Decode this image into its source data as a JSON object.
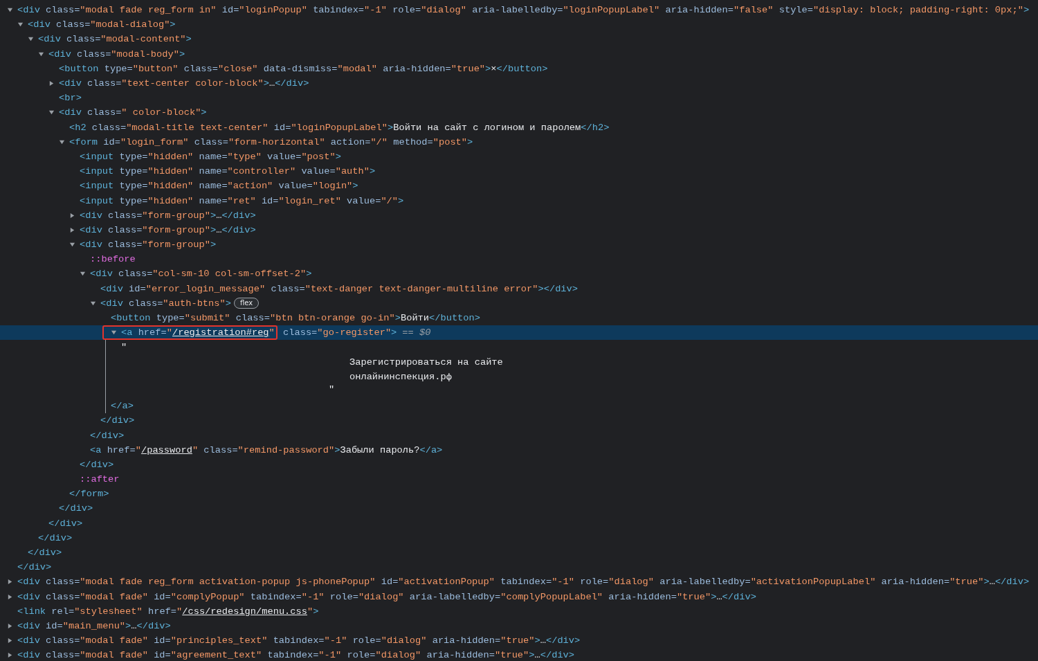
{
  "tree": [
    {
      "selected": false,
      "expanded": true,
      "open": [
        {
          "tag": "<div"
        },
        {
          "attr": " class="
        },
        {
          "val": "\"modal fade reg_form in\""
        },
        {
          "attr": " id="
        },
        {
          "val": "\"loginPopup\""
        },
        {
          "attr": " tabindex="
        },
        {
          "val": "\"-1\""
        },
        {
          "attr": " role="
        },
        {
          "val": "\"dialog\""
        },
        {
          "attr": " aria-labelledby="
        },
        {
          "val": "\"loginPopupLabel\""
        },
        {
          "attr": " aria-hidden="
        },
        {
          "val": "\"false\""
        },
        {
          "attr": " style="
        },
        {
          "val": "\"display: block; padding-right: 0px;\""
        },
        {
          "tag": ">"
        }
      ],
      "close": [
        {
          "tag": "</div>"
        }
      ],
      "children": [
        {
          "selected": false,
          "expanded": true,
          "open": [
            {
              "tag": "<div"
            },
            {
              "attr": " class="
            },
            {
              "val": "\"modal-dialog\""
            },
            {
              "tag": ">"
            }
          ],
          "close": [
            {
              "tag": "</div>"
            }
          ],
          "children": [
            {
              "selected": false,
              "expanded": true,
              "open": [
                {
                  "tag": "<div"
                },
                {
                  "attr": " class="
                },
                {
                  "val": "\"modal-content\""
                },
                {
                  "tag": ">"
                }
              ],
              "close": [
                {
                  "tag": "</div>"
                }
              ],
              "children": [
                {
                  "selected": false,
                  "expanded": true,
                  "open": [
                    {
                      "tag": "<div"
                    },
                    {
                      "attr": " class="
                    },
                    {
                      "val": "\"modal-body\""
                    },
                    {
                      "tag": ">"
                    }
                  ],
                  "close": [
                    {
                      "tag": "</div>"
                    }
                  ],
                  "children": [
                    {
                      "selected": false,
                      "open": [
                        {
                          "tag": "<button"
                        },
                        {
                          "attr": " type="
                        },
                        {
                          "val": "\"button\""
                        },
                        {
                          "attr": " class="
                        },
                        {
                          "val": "\"close\""
                        },
                        {
                          "attr": " data-dismiss="
                        },
                        {
                          "val": "\"modal\""
                        },
                        {
                          "attr": " aria-hidden="
                        },
                        {
                          "val": "\"true\""
                        },
                        {
                          "tag": ">"
                        },
                        {
                          "text": "×"
                        },
                        {
                          "tag": "</button>"
                        }
                      ]
                    },
                    {
                      "selected": false,
                      "expanded": false,
                      "open": [
                        {
                          "tag": "<div"
                        },
                        {
                          "attr": " class="
                        },
                        {
                          "val": "\"text-center color-block\""
                        },
                        {
                          "tag": ">"
                        },
                        {
                          "text": "…"
                        },
                        {
                          "tag": "</div>"
                        }
                      ]
                    },
                    {
                      "selected": false,
                      "open": [
                        {
                          "tag": "<br>"
                        }
                      ]
                    },
                    {
                      "selected": false,
                      "expanded": true,
                      "open": [
                        {
                          "tag": "<div"
                        },
                        {
                          "attr": " class="
                        },
                        {
                          "val": "\" color-block\""
                        },
                        {
                          "tag": ">"
                        }
                      ],
                      "close": [
                        {
                          "tag": "</div>"
                        }
                      ],
                      "children": [
                        {
                          "selected": false,
                          "open": [
                            {
                              "tag": "<h2"
                            },
                            {
                              "attr": " class="
                            },
                            {
                              "val": "\"modal-title text-center\""
                            },
                            {
                              "attr": " id="
                            },
                            {
                              "val": "\"loginPopupLabel\""
                            },
                            {
                              "tag": ">"
                            },
                            {
                              "text": "Войти на сайт с логином и паролем"
                            },
                            {
                              "tag": "</h2>"
                            }
                          ]
                        },
                        {
                          "selected": false,
                          "expanded": true,
                          "open": [
                            {
                              "tag": "<form"
                            },
                            {
                              "attr": " id="
                            },
                            {
                              "val": "\"login_form\""
                            },
                            {
                              "attr": " class="
                            },
                            {
                              "val": "\"form-horizontal\""
                            },
                            {
                              "attr": " action="
                            },
                            {
                              "val": "\"/\""
                            },
                            {
                              "attr": " method="
                            },
                            {
                              "val": "\"post\""
                            },
                            {
                              "tag": ">"
                            }
                          ],
                          "close": [
                            {
                              "tag": "</form>"
                            }
                          ],
                          "children": [
                            {
                              "selected": false,
                              "open": [
                                {
                                  "tag": "<input"
                                },
                                {
                                  "attr": " type="
                                },
                                {
                                  "val": "\"hidden\""
                                },
                                {
                                  "attr": " name="
                                },
                                {
                                  "val": "\"type\""
                                },
                                {
                                  "attr": " value="
                                },
                                {
                                  "val": "\"post\""
                                },
                                {
                                  "tag": ">"
                                }
                              ]
                            },
                            {
                              "selected": false,
                              "open": [
                                {
                                  "tag": "<input"
                                },
                                {
                                  "attr": " type="
                                },
                                {
                                  "val": "\"hidden\""
                                },
                                {
                                  "attr": " name="
                                },
                                {
                                  "val": "\"controller\""
                                },
                                {
                                  "attr": " value="
                                },
                                {
                                  "val": "\"auth\""
                                },
                                {
                                  "tag": ">"
                                }
                              ]
                            },
                            {
                              "selected": false,
                              "open": [
                                {
                                  "tag": "<input"
                                },
                                {
                                  "attr": " type="
                                },
                                {
                                  "val": "\"hidden\""
                                },
                                {
                                  "attr": " name="
                                },
                                {
                                  "val": "\"action\""
                                },
                                {
                                  "attr": " value="
                                },
                                {
                                  "val": "\"login\""
                                },
                                {
                                  "tag": ">"
                                }
                              ]
                            },
                            {
                              "selected": false,
                              "open": [
                                {
                                  "tag": "<input"
                                },
                                {
                                  "attr": " type="
                                },
                                {
                                  "val": "\"hidden\""
                                },
                                {
                                  "attr": " name="
                                },
                                {
                                  "val": "\"ret\""
                                },
                                {
                                  "attr": " id="
                                },
                                {
                                  "val": "\"login_ret\""
                                },
                                {
                                  "attr": " value="
                                },
                                {
                                  "val": "\"/\""
                                },
                                {
                                  "tag": ">"
                                }
                              ]
                            },
                            {
                              "selected": false,
                              "expanded": false,
                              "open": [
                                {
                                  "tag": "<div"
                                },
                                {
                                  "attr": " class="
                                },
                                {
                                  "val": "\"form-group\""
                                },
                                {
                                  "tag": ">"
                                },
                                {
                                  "text": "…"
                                },
                                {
                                  "tag": "</div>"
                                }
                              ]
                            },
                            {
                              "selected": false,
                              "expanded": false,
                              "open": [
                                {
                                  "tag": "<div"
                                },
                                {
                                  "attr": " class="
                                },
                                {
                                  "val": "\"form-group\""
                                },
                                {
                                  "tag": ">"
                                },
                                {
                                  "text": "…"
                                },
                                {
                                  "tag": "</div>"
                                }
                              ]
                            },
                            {
                              "selected": false,
                              "expanded": true,
                              "open": [
                                {
                                  "tag": "<div"
                                },
                                {
                                  "attr": " class="
                                },
                                {
                                  "val": "\"form-group\""
                                },
                                {
                                  "tag": ">"
                                }
                              ],
                              "close": [
                                {
                                  "tag": "</div>"
                                }
                              ],
                              "children": [
                                {
                                  "selected": false,
                                  "open": [
                                    {
                                      "pseudo": "::before"
                                    }
                                  ]
                                },
                                {
                                  "selected": false,
                                  "expanded": true,
                                  "open": [
                                    {
                                      "tag": "<div"
                                    },
                                    {
                                      "attr": " class="
                                    },
                                    {
                                      "val": "\"col-sm-10 col-sm-offset-2\""
                                    },
                                    {
                                      "tag": ">"
                                    }
                                  ],
                                  "close": [
                                    {
                                      "tag": "</div>"
                                    }
                                  ],
                                  "children": [
                                    {
                                      "selected": false,
                                      "open": [
                                        {
                                          "tag": "<div"
                                        },
                                        {
                                          "attr": " id="
                                        },
                                        {
                                          "val": "\"error_login_message\""
                                        },
                                        {
                                          "attr": " class="
                                        },
                                        {
                                          "val": "\"text-danger text-danger-multiline error\""
                                        },
                                        {
                                          "tag": ">"
                                        },
                                        {
                                          "tag": "</div>"
                                        }
                                      ]
                                    },
                                    {
                                      "selected": false,
                                      "expanded": true,
                                      "badge": "flex",
                                      "open": [
                                        {
                                          "tag": "<div"
                                        },
                                        {
                                          "attr": " class="
                                        },
                                        {
                                          "val": "\"auth-btns\""
                                        },
                                        {
                                          "tag": ">"
                                        }
                                      ],
                                      "close": [
                                        {
                                          "tag": "</div>"
                                        }
                                      ],
                                      "children": [
                                        {
                                          "selected": false,
                                          "open": [
                                            {
                                              "tag": "<button"
                                            },
                                            {
                                              "attr": " type="
                                            },
                                            {
                                              "val": "\"submit\""
                                            },
                                            {
                                              "attr": " class="
                                            },
                                            {
                                              "val": "\"btn btn-orange go-in\""
                                            },
                                            {
                                              "tag": ">"
                                            },
                                            {
                                              "text": "Войти"
                                            },
                                            {
                                              "tag": "</button>"
                                            }
                                          ]
                                        },
                                        {
                                          "selected": true,
                                          "expanded": true,
                                          "boxed": [
                                            {
                                              "tag": "<a"
                                            },
                                            {
                                              "attr": " href="
                                            },
                                            {
                                              "val": "\""
                                            },
                                            {
                                              "link": "/registration#reg"
                                            },
                                            {
                                              "val": "\""
                                            }
                                          ],
                                          "open": [
                                            {
                                              "attr": " class="
                                            },
                                            {
                                              "val": "\"go-register\""
                                            },
                                            {
                                              "tag": ">"
                                            }
                                          ],
                                          "marker": "== $0",
                                          "close": [
                                            {
                                              "tag": "</a>"
                                            }
                                          ],
                                          "children": [
                                            {
                                              "kind": "text",
                                              "selected": false,
                                              "quote_open": "\"",
                                              "lines": [
                                                "Зарегистрироваться на сайте",
                                                "онлайнинспекция.рф"
                                              ],
                                              "quote_close": "\""
                                            }
                                          ]
                                        }
                                      ]
                                    }
                                  ]
                                },
                                {
                                  "selected": false,
                                  "open": [
                                    {
                                      "tag": "<a"
                                    },
                                    {
                                      "attr": " href="
                                    },
                                    {
                                      "val": "\""
                                    },
                                    {
                                      "link": "/password"
                                    },
                                    {
                                      "val": "\""
                                    },
                                    {
                                      "attr": " class="
                                    },
                                    {
                                      "val": "\"remind-password\""
                                    },
                                    {
                                      "tag": ">"
                                    },
                                    {
                                      "text": "Забыли пароль?"
                                    },
                                    {
                                      "tag": "</a>"
                                    }
                                  ]
                                }
                              ]
                            },
                            {
                              "selected": false,
                              "open": [
                                {
                                  "pseudo": "::after"
                                }
                              ]
                            }
                          ]
                        }
                      ]
                    }
                  ]
                }
              ]
            }
          ]
        }
      ]
    },
    {
      "selected": false,
      "expanded": false,
      "open": [
        {
          "tag": "<div"
        },
        {
          "attr": " class="
        },
        {
          "val": "\"modal fade reg_form activation-popup js-phonePopup\""
        },
        {
          "attr": " id="
        },
        {
          "val": "\"activationPopup\""
        },
        {
          "attr": " tabindex="
        },
        {
          "val": "\"-1\""
        },
        {
          "attr": " role="
        },
        {
          "val": "\"dialog\""
        },
        {
          "attr": " aria-labelledby="
        },
        {
          "val": "\"activationPopupLabel\""
        },
        {
          "attr": " aria-hidden="
        },
        {
          "val": "\"true\""
        },
        {
          "tag": ">"
        },
        {
          "text": "…"
        },
        {
          "tag": "</div>"
        }
      ]
    },
    {
      "selected": false,
      "expanded": false,
      "open": [
        {
          "tag": "<div"
        },
        {
          "attr": " class="
        },
        {
          "val": "\"modal fade\""
        },
        {
          "attr": " id="
        },
        {
          "val": "\"complyPopup\""
        },
        {
          "attr": " tabindex="
        },
        {
          "val": "\"-1\""
        },
        {
          "attr": " role="
        },
        {
          "val": "\"dialog\""
        },
        {
          "attr": " aria-labelledby="
        },
        {
          "val": "\"complyPopupLabel\""
        },
        {
          "attr": " aria-hidden="
        },
        {
          "val": "\"true\""
        },
        {
          "tag": ">"
        },
        {
          "text": "…"
        },
        {
          "tag": "</div>"
        }
      ]
    },
    {
      "selected": false,
      "open": [
        {
          "tag": "<link"
        },
        {
          "attr": " rel="
        },
        {
          "val": "\"stylesheet\""
        },
        {
          "attr": " href="
        },
        {
          "val": "\""
        },
        {
          "link": "/css/redesign/menu.css"
        },
        {
          "val": "\""
        },
        {
          "tag": ">"
        }
      ]
    },
    {
      "selected": false,
      "expanded": false,
      "open": [
        {
          "tag": "<div"
        },
        {
          "attr": " id="
        },
        {
          "val": "\"main_menu\""
        },
        {
          "tag": ">"
        },
        {
          "text": "…"
        },
        {
          "tag": "</div>"
        }
      ]
    },
    {
      "selected": false,
      "expanded": false,
      "open": [
        {
          "tag": "<div"
        },
        {
          "attr": " class="
        },
        {
          "val": "\"modal fade\""
        },
        {
          "attr": " id="
        },
        {
          "val": "\"principles_text\""
        },
        {
          "attr": " tabindex="
        },
        {
          "val": "\"-1\""
        },
        {
          "attr": " role="
        },
        {
          "val": "\"dialog\""
        },
        {
          "attr": " aria-hidden="
        },
        {
          "val": "\"true\""
        },
        {
          "tag": ">"
        },
        {
          "text": "…"
        },
        {
          "tag": "</div>"
        }
      ]
    },
    {
      "selected": false,
      "expanded": false,
      "open": [
        {
          "tag": "<div"
        },
        {
          "attr": " class="
        },
        {
          "val": "\"modal fade\""
        },
        {
          "attr": " id="
        },
        {
          "val": "\"agreement_text\""
        },
        {
          "attr": " tabindex="
        },
        {
          "val": "\"-1\""
        },
        {
          "attr": " role="
        },
        {
          "val": "\"dialog\""
        },
        {
          "attr": " aria-hidden="
        },
        {
          "val": "\"true\""
        },
        {
          "tag": ">"
        },
        {
          "text": "…"
        },
        {
          "tag": "</div>"
        }
      ]
    }
  ]
}
